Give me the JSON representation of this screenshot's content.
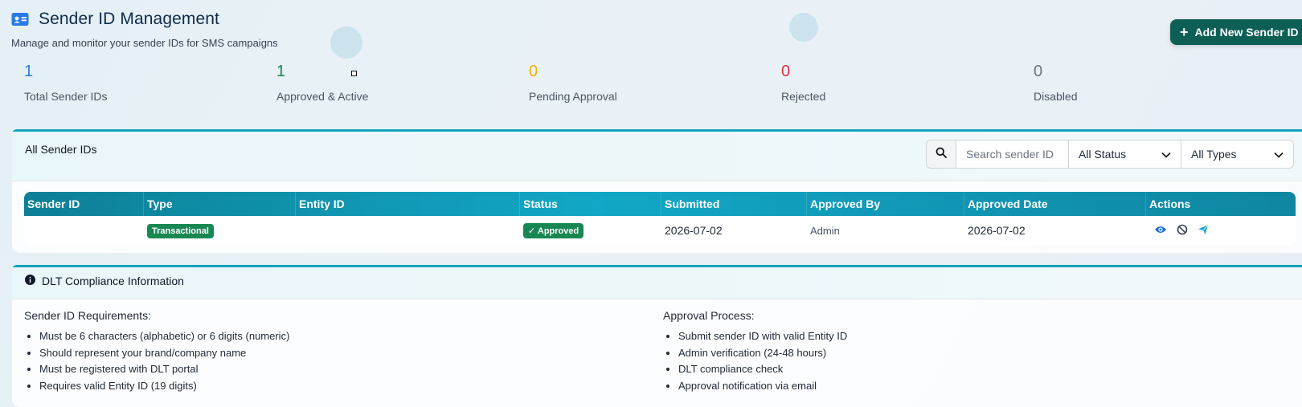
{
  "header": {
    "title": "Sender ID Management",
    "subtitle": "Manage and monitor your sender IDs for SMS campaigns",
    "add_button": "Add New Sender ID"
  },
  "stats": [
    {
      "value": "1",
      "label": "Total Sender IDs",
      "color": "#2a7ae4"
    },
    {
      "value": "1",
      "label": "Approved & Active",
      "color": "#198754"
    },
    {
      "value": "0",
      "label": "Pending Approval",
      "color": "#f4b000"
    },
    {
      "value": "0",
      "label": "Rejected",
      "color": "#dc3545"
    },
    {
      "value": "0",
      "label": "Disabled",
      "color": "#6c757d"
    }
  ],
  "senders": {
    "card_title": "All Sender IDs",
    "search_placeholder": "Search sender ID",
    "status_filter": "All Status",
    "type_filter": "All Types",
    "columns": [
      "Sender ID",
      "Type",
      "Entity ID",
      "Status",
      "Submitted",
      "Approved By",
      "Approved Date",
      "Actions"
    ],
    "rows": [
      {
        "sender_id": "",
        "type": "Transactional",
        "entity_id": "",
        "status": "Approved",
        "submitted": "2026-07-02",
        "approved_by": "Admin",
        "approved_date": "2026-07-02"
      }
    ]
  },
  "dlt": {
    "title": "DLT Compliance Information",
    "requirements_heading": "Sender ID Requirements:",
    "requirements": [
      "Must be 6 characters (alphabetic) or 6 digits (numeric)",
      "Should represent your brand/company name",
      "Must be registered with DLT portal",
      "Requires valid Entity ID (19 digits)"
    ],
    "process_heading": "Approval Process:",
    "process": [
      "Submit sender ID with valid Entity ID",
      "Admin verification (24-48 hours)",
      "DLT compliance check",
      "Approval notification via email"
    ]
  },
  "colors": {
    "accent": "#14a3bd",
    "primary_button": "#0d5f55",
    "success": "#198754",
    "view_icon": "#1a6fe0",
    "send_icon": "#1aa3d9"
  },
  "icons": [
    "id-card-icon",
    "plus-icon",
    "search-icon",
    "chevron-down-icon",
    "check-icon",
    "eye-icon",
    "ban-icon",
    "send-icon",
    "info-icon"
  ]
}
